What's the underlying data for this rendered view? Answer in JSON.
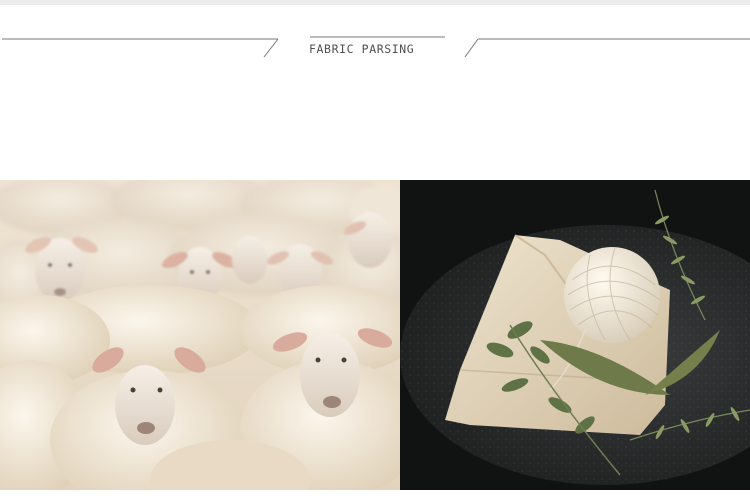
{
  "header": {
    "title": "FABRIC PARSING"
  },
  "photos": [
    {
      "icon": "sheep-flock-photo"
    },
    {
      "icon": "linen-bag-twine-herbs-photo"
    }
  ]
}
